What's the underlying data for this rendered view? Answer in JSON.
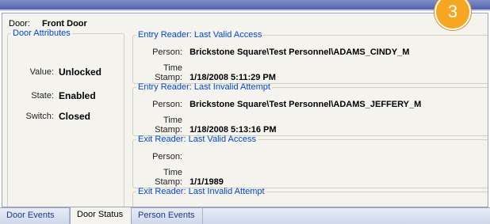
{
  "callout_number": "3",
  "door": {
    "label": "Door:",
    "value": "Front Door"
  },
  "attributes": {
    "legend": "Door Attributes",
    "rows": [
      {
        "key": "Value:",
        "value": "Unlocked"
      },
      {
        "key": "State:",
        "value": "Enabled"
      },
      {
        "key": "Switch:",
        "value": "Closed"
      }
    ]
  },
  "readers": [
    {
      "legend": "Entry Reader: Last Valid Access",
      "person_label": "Person:",
      "person": "Brickstone Square\\Test Personnel\\ADAMS_CINDY_M",
      "time_label": "Time Stamp:",
      "time": "1/18/2008 5:11:29 PM"
    },
    {
      "legend": "Entry Reader: Last Invalid Attempt",
      "person_label": "Person:",
      "person": "Brickstone Square\\Test Personnel\\ADAMS_JEFFERY_M",
      "time_label": "Time Stamp:",
      "time": "1/18/2008 5:13:16 PM"
    },
    {
      "legend": "Exit Reader: Last Valid Access",
      "person_label": "Person:",
      "person": "",
      "time_label": "Time Stamp:",
      "time": "1/1/1989"
    },
    {
      "legend": "Exit Reader: Last Invalid Attempt"
    }
  ],
  "tabs": [
    {
      "label": "Door Events"
    },
    {
      "label": "Door Status",
      "active": true
    },
    {
      "label": "Person Events"
    }
  ],
  "colors": {
    "legend_text": "#0046d5",
    "panel_bg": "#f4f3ee",
    "callout": "#f5a623"
  }
}
